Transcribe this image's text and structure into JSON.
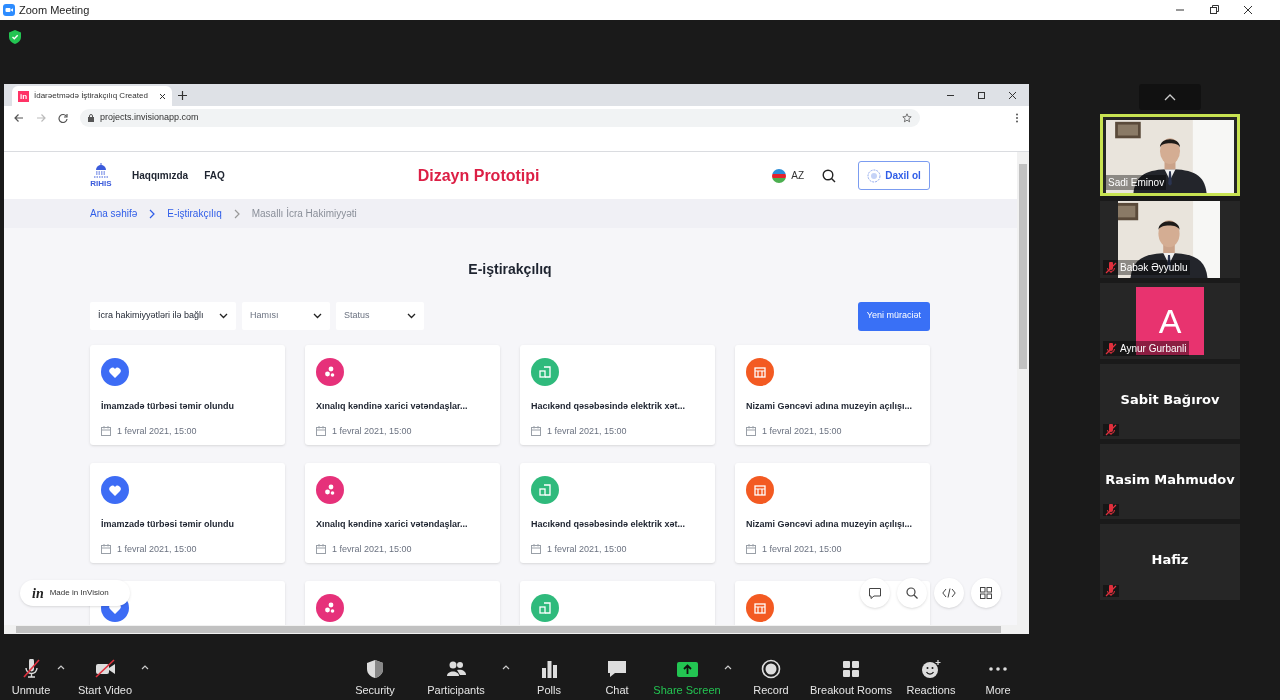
{
  "window": {
    "title": "Zoom Meeting"
  },
  "browser": {
    "tab": {
      "favicon": "in",
      "title": "İdarəetmədə İştirakçılıq Created"
    },
    "url": "projects.invisionapp.com"
  },
  "site": {
    "logo_text": "RIHIS",
    "nav": [
      "Haqqımızda",
      "FAQ"
    ],
    "title": "Dizayn Prototipi",
    "language": "AZ",
    "login": "Daxil ol"
  },
  "breadcrumb": [
    {
      "label": "Ana səhifə",
      "current": false
    },
    {
      "label": "E-iştirakçılıq",
      "current": false
    },
    {
      "label": "Masallı İcra Hakimiyyəti",
      "current": true
    }
  ],
  "heading": "E-iştirakçılıq",
  "filters": [
    {
      "value": "İcra hakimiyyətləri ilə bağlı"
    },
    {
      "placeholder": "Hamısı"
    },
    {
      "placeholder": "Status"
    }
  ],
  "new_button": "Yeni müraciət",
  "cards": [
    {
      "kind": "heart",
      "color": "#3d6cf5",
      "title": "İmamzadə türbəsi təmir olundu",
      "date": "1 fevral 2021, 15:00"
    },
    {
      "kind": "dots",
      "color": "#e6317a",
      "title": "Xınalıq kəndinə xarici vətəndaşlar...",
      "date": "1 fevral 2021, 15:00"
    },
    {
      "kind": "building",
      "color": "#2fba7c",
      "title": "Hacıkənd qəsəbəsində elektrik xət...",
      "date": "1 fevral 2021, 15:00"
    },
    {
      "kind": "shop",
      "color": "#f35a22",
      "title": "Nizami Gəncəvi adına muzeyin açılışı...",
      "date": "1 fevral 2021, 15:00"
    },
    {
      "kind": "heart",
      "color": "#3d6cf5",
      "title": "İmamzadə türbəsi təmir olundu",
      "date": "1 fevral 2021, 15:00"
    },
    {
      "kind": "dots",
      "color": "#e6317a",
      "title": "Xınalıq kəndinə xarici vətəndaşlar...",
      "date": "1 fevral 2021, 15:00"
    },
    {
      "kind": "building",
      "color": "#2fba7c",
      "title": "Hacıkənd qəsəbəsində elektrik xət...",
      "date": "1 fevral 2021, 15:00"
    },
    {
      "kind": "shop",
      "color": "#f35a22",
      "title": "Nizami Gəncəvi adına muzeyin açılışı...",
      "date": "1 fevral 2021, 15:00"
    },
    {
      "kind": "heart",
      "color": "#3d6cf5"
    },
    {
      "kind": "dots",
      "color": "#e6317a"
    },
    {
      "kind": "building",
      "color": "#2fba7c"
    },
    {
      "kind": "shop",
      "color": "#f35a22"
    }
  ],
  "invision_badge": {
    "logo": "in",
    "label": "Made in InVision"
  },
  "participants": [
    {
      "name": "Sadi Eminov",
      "kind": "video",
      "speaking": true,
      "muted": false
    },
    {
      "name": "Babək Əyyublu",
      "kind": "video",
      "speaking": false,
      "muted": true
    },
    {
      "name": "Aynur Gurbanli",
      "kind": "avatar",
      "letter": "A",
      "color": "#e8336f",
      "speaking": false,
      "muted": true
    },
    {
      "name": "Sabit Bağırov",
      "kind": "name",
      "speaking": false,
      "muted": true
    },
    {
      "name": "Rasim Mahmudov",
      "kind": "name",
      "speaking": false,
      "muted": true
    },
    {
      "name": "Hafiz",
      "kind": "name",
      "speaking": false,
      "muted": true
    }
  ],
  "toolbar": [
    {
      "label": "Unmute",
      "kind": "mic",
      "caret": true,
      "active": false
    },
    {
      "label": "Start Video",
      "kind": "camera",
      "caret": true,
      "active": false
    },
    {
      "label": "Security",
      "kind": "shield",
      "caret": false,
      "active": false
    },
    {
      "label": "Participants",
      "kind": "people",
      "caret": true,
      "active": false
    },
    {
      "label": "Polls",
      "kind": "bars",
      "caret": false,
      "active": false
    },
    {
      "label": "Chat",
      "kind": "chat",
      "caret": false,
      "active": false
    },
    {
      "label": "Share Screen",
      "kind": "share",
      "caret": true,
      "active": true
    },
    {
      "label": "Record",
      "kind": "record",
      "caret": false,
      "active": false
    },
    {
      "label": "Breakout Rooms",
      "kind": "grid",
      "caret": false,
      "active": false
    },
    {
      "label": "Reactions",
      "kind": "smile",
      "caret": false,
      "active": false
    },
    {
      "label": "More",
      "kind": "more",
      "caret": false,
      "active": false
    }
  ]
}
